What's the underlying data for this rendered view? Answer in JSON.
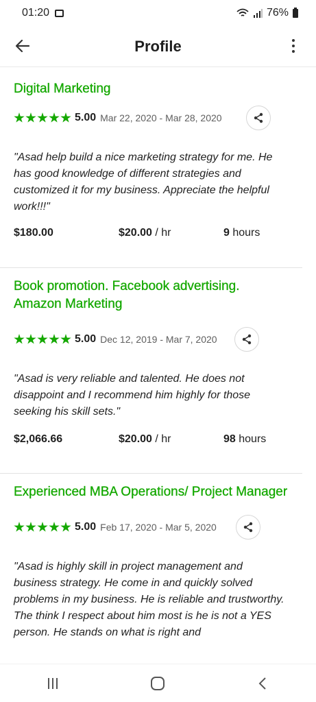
{
  "status": {
    "time": "01:20",
    "battery": "76%"
  },
  "header": {
    "title": "Profile"
  },
  "jobs": [
    {
      "title": "Digital Marketing",
      "rating": "5.00",
      "dates": "Mar 22, 2020 - Mar 28, 2020",
      "quote": "\"Asad help build a nice marketing strategy for me. He has good knowledge of different strategies and customized it for my business. Appreciate the helpful work!!!\"",
      "total": "$180.00",
      "rate": "$20.00",
      "rate_unit": " / hr",
      "hours": "9",
      "hours_unit": " hours"
    },
    {
      "title": "Book promotion. Facebook advertising. Amazon Marketing",
      "rating": "5.00",
      "dates": "Dec 12, 2019 - Mar 7, 2020",
      "quote": "\"Asad is very reliable and talented. He does not disappoint and I recommend him highly for those seeking his skill sets.\"",
      "total": "$2,066.66",
      "rate": "$20.00",
      "rate_unit": " / hr",
      "hours": "98",
      "hours_unit": " hours"
    },
    {
      "title": "Experienced MBA Operations/ Project Manager",
      "rating": "5.00",
      "dates": "Feb 17, 2020 - Mar 5, 2020",
      "quote": "\"Asad is highly skill in project management and business strategy. He come in and quickly solved problems in my business. He is reliable and trustworthy. The think I respect about him most is he is not a YES person. He stands on what is right and",
      "total": "",
      "rate": "",
      "rate_unit": "",
      "hours": "",
      "hours_unit": ""
    }
  ],
  "colors": {
    "accent": "#14a800",
    "text": "#1f1f1f",
    "muted": "#5e5e5e"
  }
}
